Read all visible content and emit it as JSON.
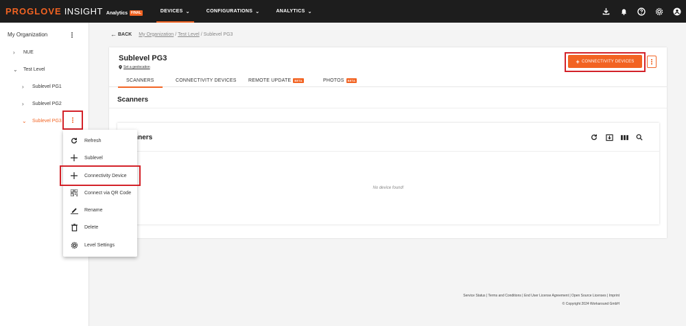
{
  "brand": {
    "pro": "PROGLOVE",
    "insight": "INSIGHT",
    "analytics": "Analytics",
    "badge": "FINAL"
  },
  "nav": [
    {
      "label": "DEVICES"
    },
    {
      "label": "CONFIGURATIONS"
    },
    {
      "label": "ANALYTICS"
    }
  ],
  "top_icons": [
    "download-icon",
    "bell-icon",
    "help-icon",
    "settings-icon",
    "account-icon"
  ],
  "sidebar": {
    "title": "My Organization",
    "items": [
      {
        "label": "NUE",
        "expanded": false
      },
      {
        "label": "Test Level",
        "expanded": true
      },
      {
        "label": "Sublevel PG1",
        "expanded": false
      },
      {
        "label": "Sublevel PG2",
        "expanded": false
      },
      {
        "label": "Sublevel PG3",
        "expanded": true,
        "active": true
      }
    ]
  },
  "breadcrumb": {
    "back": "BACK",
    "crumbs": [
      "My Organization",
      "Test Level"
    ],
    "current": "Sublevel PG3"
  },
  "page": {
    "title": "Sublevel PG3",
    "geolocation": "Set a geolocation",
    "add_button": "CONNECTIVITY DEVICES",
    "tabs": [
      {
        "label": "SCANNERS",
        "active": true
      },
      {
        "label": "CONNECTIVITY DEVICES"
      },
      {
        "label": "REMOTE UPDATE",
        "badge": "BETA"
      },
      {
        "label": "PHOTOS",
        "badge": "BETA"
      }
    ],
    "section_title": "Scanners",
    "inner_title": "nners",
    "empty_message": "No device found!"
  },
  "context_menu": [
    {
      "icon": "refresh-icon",
      "label": "Refresh"
    },
    {
      "icon": "plus-icon",
      "label": "Sublevel"
    },
    {
      "icon": "plus-icon",
      "label": "Connectivity Device"
    },
    {
      "icon": "qr-code-icon",
      "label": "Connect via QR Code"
    },
    {
      "icon": "pencil-icon",
      "label": "Rename"
    },
    {
      "icon": "trash-icon",
      "label": "Delete"
    },
    {
      "icon": "gear-icon",
      "label": "Level Settings"
    }
  ],
  "footer": {
    "links": "Service Status | Terms and Conditions | End User License Agreement | Open Source Licenses | Imprint",
    "copyright": "© Copyright 2024 Workaround GmbH"
  },
  "colors": {
    "accent": "#f26322",
    "highlight": "#d32027",
    "topbar": "#1d1d1d"
  }
}
